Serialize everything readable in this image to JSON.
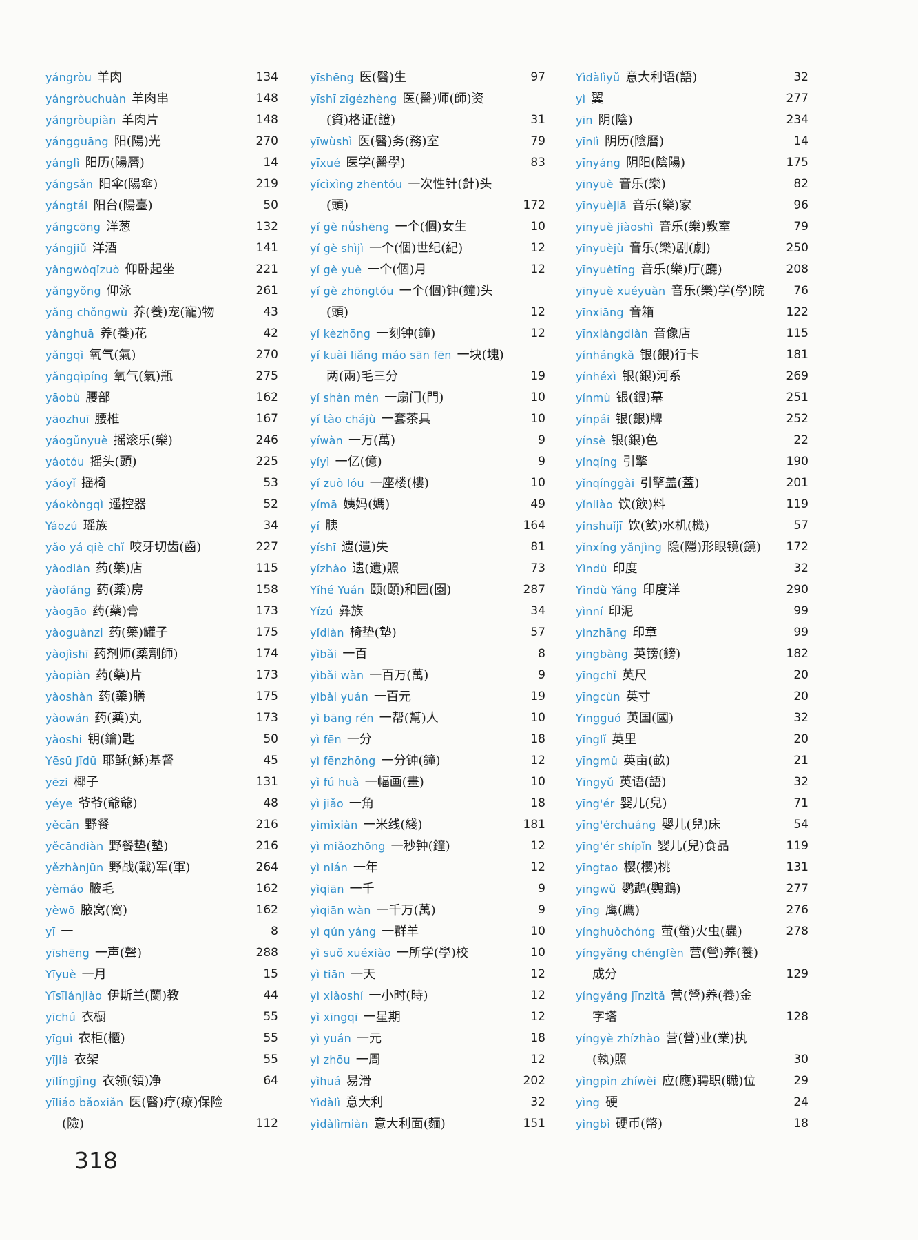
{
  "page_number": "318",
  "columns": [
    [
      {
        "py": "yángròu",
        "hz": "羊肉",
        "page": "134"
      },
      {
        "py": "yángròuchuàn",
        "hz": "羊肉串",
        "page": "148"
      },
      {
        "py": "yángròupiàn",
        "hz": "羊肉片",
        "page": "148"
      },
      {
        "py": "yángguāng",
        "hz": "阳(陽)光",
        "page": "270"
      },
      {
        "py": "yánglì",
        "hz": "阳历(陽曆)",
        "page": "14"
      },
      {
        "py": "yángsǎn",
        "hz": "阳伞(陽傘)",
        "page": "219"
      },
      {
        "py": "yángtái",
        "hz": "阳台(陽臺)",
        "page": "50"
      },
      {
        "py": "yángcōng",
        "hz": "洋葱",
        "page": "132"
      },
      {
        "py": "yángjiǔ",
        "hz": "洋酒",
        "page": "141"
      },
      {
        "py": "yǎngwòqǐzuò",
        "hz": "仰卧起坐",
        "page": "221"
      },
      {
        "py": "yǎngyǒng",
        "hz": "仰泳",
        "page": "261"
      },
      {
        "py": "yǎng chǒngwù",
        "hz": "养(養)宠(寵)物",
        "page": "43"
      },
      {
        "py": "yǎnghuā",
        "hz": "养(養)花",
        "page": "42"
      },
      {
        "py": "yǎngqì",
        "hz": "氧气(氣)",
        "page": "270"
      },
      {
        "py": "yǎngqìpíng",
        "hz": "氧气(氣)瓶",
        "page": "275"
      },
      {
        "py": "yāobù",
        "hz": "腰部",
        "page": "162"
      },
      {
        "py": "yāozhuī",
        "hz": "腰椎",
        "page": "167"
      },
      {
        "py": "yáogǔnyuè",
        "hz": "摇滚乐(樂)",
        "page": "246"
      },
      {
        "py": "yáotóu",
        "hz": "摇头(頭)",
        "page": "225"
      },
      {
        "py": "yáoyǐ",
        "hz": "摇椅",
        "page": "53"
      },
      {
        "py": "yáokòngqì",
        "hz": "遥控器",
        "page": "52"
      },
      {
        "py": "Yáozú",
        "hz": "瑶族",
        "page": "34"
      },
      {
        "py": "yǎo yá qiè chǐ",
        "hz": "咬牙切齿(齒)",
        "page": "227"
      },
      {
        "py": "yàodiàn",
        "hz": "药(藥)店",
        "page": "115"
      },
      {
        "py": "yàofáng",
        "hz": "药(藥)房",
        "page": "158"
      },
      {
        "py": "yàogāo",
        "hz": "药(藥)膏",
        "page": "173"
      },
      {
        "py": "yàoguànzi",
        "hz": "药(藥)罐子",
        "page": "175"
      },
      {
        "py": "yàojìshī",
        "hz": "药剂师(藥劑師)",
        "page": "174"
      },
      {
        "py": "yàopiàn",
        "hz": "药(藥)片",
        "page": "173"
      },
      {
        "py": "yàoshàn",
        "hz": "药(藥)膳",
        "page": "175"
      },
      {
        "py": "yàowán",
        "hz": "药(藥)丸",
        "page": "173"
      },
      {
        "py": "yàoshi",
        "hz": "钥(鑰)匙",
        "page": "50"
      },
      {
        "py": "Yēsū Jīdū",
        "hz": "耶稣(穌)基督",
        "page": "45"
      },
      {
        "py": "yēzi",
        "hz": "椰子",
        "page": "131"
      },
      {
        "py": "yéye",
        "hz": "爷爷(爺爺)",
        "page": "48"
      },
      {
        "py": "yěcān",
        "hz": "野餐",
        "page": "216"
      },
      {
        "py": "yěcāndiàn",
        "hz": "野餐垫(墊)",
        "page": "216"
      },
      {
        "py": "yězhànjūn",
        "hz": "野战(戰)军(軍)",
        "page": "264"
      },
      {
        "py": "yèmáo",
        "hz": "腋毛",
        "page": "162"
      },
      {
        "py": "yèwō",
        "hz": "腋窝(窩)",
        "page": "162"
      },
      {
        "py": "yī",
        "hz": "一",
        "page": "8"
      },
      {
        "py": "yīshēng",
        "hz": "一声(聲)",
        "page": "288"
      },
      {
        "py": "Yīyuè",
        "hz": "一月",
        "page": "15"
      },
      {
        "py": "Yīsīlánjiào",
        "hz": "伊斯兰(蘭)教",
        "page": "44"
      },
      {
        "py": "yīchú",
        "hz": "衣橱",
        "page": "55"
      },
      {
        "py": "yīguì",
        "hz": "衣柜(櫃)",
        "page": "55"
      },
      {
        "py": "yījià",
        "hz": "衣架",
        "page": "55"
      },
      {
        "py": "yīlǐngjìng",
        "hz": "衣领(領)净",
        "page": "64"
      },
      {
        "py": "yīliáo bǎoxiǎn",
        "hz": "医(醫)疗(療)保险",
        "cont": "(險)",
        "page": "112"
      }
    ],
    [
      {
        "py": "yīshēng",
        "hz": "医(醫)生",
        "page": "97"
      },
      {
        "py": "yīshī zīgézhèng",
        "hz": "医(醫)师(師)资",
        "cont": "(資)格证(證)",
        "page": "31"
      },
      {
        "py": "yīwùshì",
        "hz": "医(醫)务(務)室",
        "page": "79"
      },
      {
        "py": "yīxué",
        "hz": "医学(醫學)",
        "page": "83"
      },
      {
        "py": "yícìxìng zhēntóu",
        "hz": "一次性针(針)头",
        "cont": "(頭)",
        "page": "172"
      },
      {
        "py": "yí gè nǚshēng",
        "hz": "一个(個)女生",
        "page": "10"
      },
      {
        "py": "yí gè shìjì",
        "hz": "一个(個)世纪(紀)",
        "page": "12"
      },
      {
        "py": "yí gè yuè",
        "hz": "一个(個)月",
        "page": "12"
      },
      {
        "py": "yí gè zhōngtóu",
        "hz": "一个(個)钟(鐘)头",
        "cont": "(頭)",
        "page": "12"
      },
      {
        "py": "yí kèzhōng",
        "hz": "一刻钟(鐘)",
        "page": "12"
      },
      {
        "py": "yí kuài liǎng máo sān fēn",
        "hz": "一块(塊)",
        "cont": "两(兩)毛三分",
        "page": "19"
      },
      {
        "py": "yí shàn mén",
        "hz": "一扇门(門)",
        "page": "10"
      },
      {
        "py": "yí tào chájù",
        "hz": "一套茶具",
        "page": "10"
      },
      {
        "py": "yíwàn",
        "hz": "一万(萬)",
        "page": "9"
      },
      {
        "py": "yíyì",
        "hz": "一亿(億)",
        "page": "9"
      },
      {
        "py": "yí zuò lóu",
        "hz": "一座楼(樓)",
        "page": "10"
      },
      {
        "py": "yímā",
        "hz": "姨妈(媽)",
        "page": "49"
      },
      {
        "py": "yí",
        "hz": "胰",
        "page": "164"
      },
      {
        "py": "yíshī",
        "hz": "遗(遺)失",
        "page": "81"
      },
      {
        "py": "yízhào",
        "hz": "遗(遺)照",
        "page": "73"
      },
      {
        "py": "Yíhé Yuán",
        "hz": "颐(頤)和园(園)",
        "page": "287"
      },
      {
        "py": "Yízú",
        "hz": "彝族",
        "page": "34"
      },
      {
        "py": "yǐdiàn",
        "hz": "椅垫(墊)",
        "page": "57"
      },
      {
        "py": "yìbǎi",
        "hz": "一百",
        "page": "8"
      },
      {
        "py": "yìbǎi wàn",
        "hz": "一百万(萬)",
        "page": "9"
      },
      {
        "py": "yìbǎi yuán",
        "hz": "一百元",
        "page": "19"
      },
      {
        "py": "yì bāng rén",
        "hz": "一帮(幫)人",
        "page": "10"
      },
      {
        "py": "yì fēn",
        "hz": "一分",
        "page": "18"
      },
      {
        "py": "yì fēnzhōng",
        "hz": "一分钟(鐘)",
        "page": "12"
      },
      {
        "py": "yì fú huà",
        "hz": "一幅画(畫)",
        "page": "10"
      },
      {
        "py": "yì jiǎo",
        "hz": "一角",
        "page": "18"
      },
      {
        "py": "yìmǐxiàn",
        "hz": "一米线(綫)",
        "page": "181"
      },
      {
        "py": "yì miǎozhōng",
        "hz": "一秒钟(鐘)",
        "page": "12"
      },
      {
        "py": "yì nián",
        "hz": "一年",
        "page": "12"
      },
      {
        "py": "yìqiān",
        "hz": "一千",
        "page": "9"
      },
      {
        "py": "yìqiān wàn",
        "hz": "一千万(萬)",
        "page": "9"
      },
      {
        "py": "yì qún yáng",
        "hz": "一群羊",
        "page": "10"
      },
      {
        "py": "yì suǒ xuéxiào",
        "hz": "一所学(學)校",
        "page": "10"
      },
      {
        "py": "yì tiān",
        "hz": "一天",
        "page": "12"
      },
      {
        "py": "yì xiǎoshí",
        "hz": "一小时(時)",
        "page": "12"
      },
      {
        "py": "yì xīngqī",
        "hz": "一星期",
        "page": "12"
      },
      {
        "py": "yì yuán",
        "hz": "一元",
        "page": "18"
      },
      {
        "py": "yì zhōu",
        "hz": "一周",
        "page": "12"
      },
      {
        "py": "yìhuá",
        "hz": "易滑",
        "page": "202"
      },
      {
        "py": "Yìdàlì",
        "hz": "意大利",
        "page": "32"
      },
      {
        "py": "yìdàlìmiàn",
        "hz": "意大利面(麵)",
        "page": "151"
      }
    ],
    [
      {
        "py": "Yìdàlìyǔ",
        "hz": "意大利语(語)",
        "page": "32"
      },
      {
        "py": "yì",
        "hz": "翼",
        "page": "277"
      },
      {
        "py": "yīn",
        "hz": "阴(陰)",
        "page": "234"
      },
      {
        "py": "yīnlì",
        "hz": "阴历(陰曆)",
        "page": "14"
      },
      {
        "py": "yīnyáng",
        "hz": "阴阳(陰陽)",
        "page": "175"
      },
      {
        "py": "yīnyuè",
        "hz": "音乐(樂)",
        "page": "82"
      },
      {
        "py": "yīnyuèjiā",
        "hz": "音乐(樂)家",
        "page": "96"
      },
      {
        "py": "yīnyuè jiàoshì",
        "hz": "音乐(樂)教室",
        "page": "79"
      },
      {
        "py": "yīnyuèjù",
        "hz": "音乐(樂)剧(劇)",
        "page": "250"
      },
      {
        "py": "yīnyuètīng",
        "hz": "音乐(樂)厅(廳)",
        "page": "208"
      },
      {
        "py": "yīnyuè xuéyuàn",
        "hz": "音乐(樂)学(學)院",
        "page": "76"
      },
      {
        "py": "yīnxiāng",
        "hz": "音箱",
        "page": "122"
      },
      {
        "py": "yīnxiàngdiàn",
        "hz": "音像店",
        "page": "115"
      },
      {
        "py": "yínhángkǎ",
        "hz": "银(銀)行卡",
        "page": "181"
      },
      {
        "py": "yínhéxì",
        "hz": "银(銀)河系",
        "page": "269"
      },
      {
        "py": "yínmù",
        "hz": "银(銀)幕",
        "page": "251"
      },
      {
        "py": "yínpái",
        "hz": "银(銀)牌",
        "page": "252"
      },
      {
        "py": "yínsè",
        "hz": "银(銀)色",
        "page": "22"
      },
      {
        "py": "yǐnqíng",
        "hz": "引擎",
        "page": "190"
      },
      {
        "py": "yǐnqínggài",
        "hz": "引擎盖(蓋)",
        "page": "201"
      },
      {
        "py": "yǐnliào",
        "hz": "饮(飲)料",
        "page": "119"
      },
      {
        "py": "yǐnshuǐjī",
        "hz": "饮(飲)水机(機)",
        "page": "57"
      },
      {
        "py": "yǐnxíng yǎnjìng",
        "hz": "隐(隱)形眼镜(鏡)",
        "page": "172"
      },
      {
        "py": "Yìndù",
        "hz": "印度",
        "page": "32"
      },
      {
        "py": "Yìndù Yáng",
        "hz": "印度洋",
        "page": "290"
      },
      {
        "py": "yìnní",
        "hz": "印泥",
        "page": "99"
      },
      {
        "py": "yìnzhāng",
        "hz": "印章",
        "page": "99"
      },
      {
        "py": "yīngbàng",
        "hz": "英镑(鎊)",
        "page": "182"
      },
      {
        "py": "yīngchǐ",
        "hz": "英尺",
        "page": "20"
      },
      {
        "py": "yīngcùn",
        "hz": "英寸",
        "page": "20"
      },
      {
        "py": "Yīngguó",
        "hz": "英国(國)",
        "page": "32"
      },
      {
        "py": "yīnglǐ",
        "hz": "英里",
        "page": "20"
      },
      {
        "py": "yīngmǔ",
        "hz": "英亩(畝)",
        "page": "21"
      },
      {
        "py": "Yīngyǔ",
        "hz": "英语(語)",
        "page": "32"
      },
      {
        "py": "yīng'ér",
        "hz": "婴儿(兒)",
        "page": "71"
      },
      {
        "py": "yīng'érchuáng",
        "hz": "婴儿(兒)床",
        "page": "54"
      },
      {
        "py": "yīng'ér shípǐn",
        "hz": "婴儿(兒)食品",
        "page": "119"
      },
      {
        "py": "yīngtao",
        "hz": "樱(櫻)桃",
        "page": "131"
      },
      {
        "py": "yīngwǔ",
        "hz": "鹦鹉(鸚鵡)",
        "page": "277"
      },
      {
        "py": "yīng",
        "hz": "鹰(鷹)",
        "page": "276"
      },
      {
        "py": "yínghuǒchóng",
        "hz": "萤(螢)火虫(蟲)",
        "page": "278"
      },
      {
        "py": "yíngyǎng chéngfèn",
        "hz": "营(營)养(養)",
        "cont": "成分",
        "page": "129"
      },
      {
        "py": "yíngyǎng jīnzìtǎ",
        "hz": "营(營)养(養)金",
        "cont": "字塔",
        "page": "128"
      },
      {
        "py": "yíngyè zhízhào",
        "hz": "营(營)业(業)执",
        "cont": "(執)照",
        "page": "30"
      },
      {
        "py": "yìngpìn zhíwèi",
        "hz": "应(應)聘职(職)位",
        "page": "29"
      },
      {
        "py": "yìng",
        "hz": "硬",
        "page": "24"
      },
      {
        "py": "yìngbì",
        "hz": "硬币(幣)",
        "page": "18"
      }
    ]
  ]
}
